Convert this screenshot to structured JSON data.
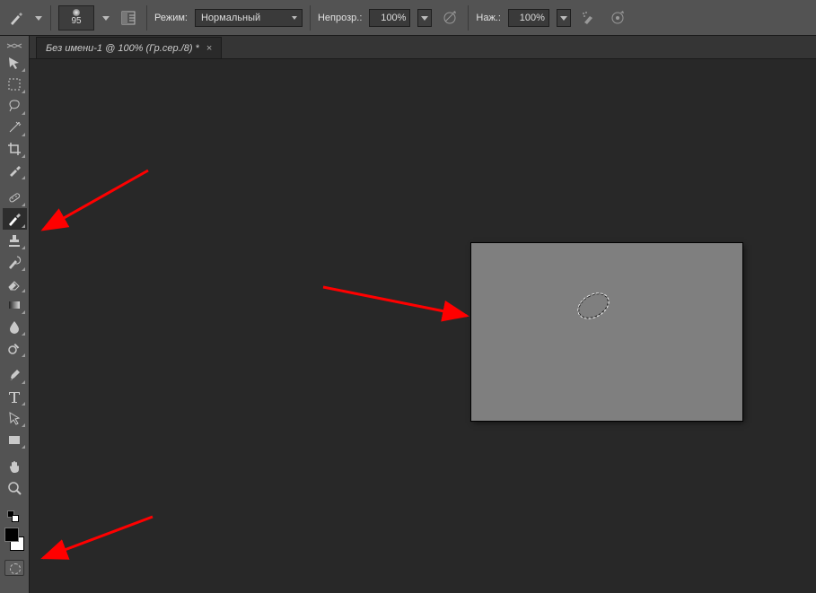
{
  "options_bar": {
    "brush_size": "95",
    "mode_label": "Режим:",
    "mode_value": "Нормальный",
    "opacity_label": "Непрозр.:",
    "opacity_value": "100%",
    "flow_label": "Наж.:",
    "flow_value": "100%"
  },
  "tab": {
    "title": "Без имени-1 @ 100% (Гр.сер./8) *"
  },
  "tools": [
    {
      "name": "move-tool",
      "icon": "move",
      "corner": true
    },
    {
      "name": "marquee-tool",
      "icon": "marquee",
      "corner": true
    },
    {
      "name": "lasso-tool",
      "icon": "lasso",
      "corner": true
    },
    {
      "name": "quick-select-tool",
      "icon": "wand",
      "corner": true
    },
    {
      "name": "crop-tool",
      "icon": "crop",
      "corner": true
    },
    {
      "name": "eyedropper-tool",
      "icon": "eyedropper",
      "corner": true
    },
    {
      "name": "heal-tool",
      "icon": "bandage",
      "corner": true
    },
    {
      "name": "brush-tool",
      "icon": "brush",
      "corner": true,
      "selected": true
    },
    {
      "name": "stamp-tool",
      "icon": "stamp",
      "corner": true
    },
    {
      "name": "history-brush-tool",
      "icon": "historybrush",
      "corner": true
    },
    {
      "name": "eraser-tool",
      "icon": "eraser",
      "corner": true
    },
    {
      "name": "gradient-tool",
      "icon": "gradient",
      "corner": true
    },
    {
      "name": "blur-tool",
      "icon": "blur",
      "corner": true
    },
    {
      "name": "dodge-tool",
      "icon": "dodge",
      "corner": true
    },
    {
      "name": "pen-tool",
      "icon": "pen",
      "corner": true
    },
    {
      "name": "type-tool",
      "icon": "type",
      "corner": true
    },
    {
      "name": "path-select-tool",
      "icon": "pathsel",
      "corner": true
    },
    {
      "name": "shape-tool",
      "icon": "shape",
      "corner": true
    },
    {
      "name": "hand-tool",
      "icon": "hand",
      "corner": false
    },
    {
      "name": "zoom-tool",
      "icon": "zoom",
      "corner": false
    }
  ]
}
